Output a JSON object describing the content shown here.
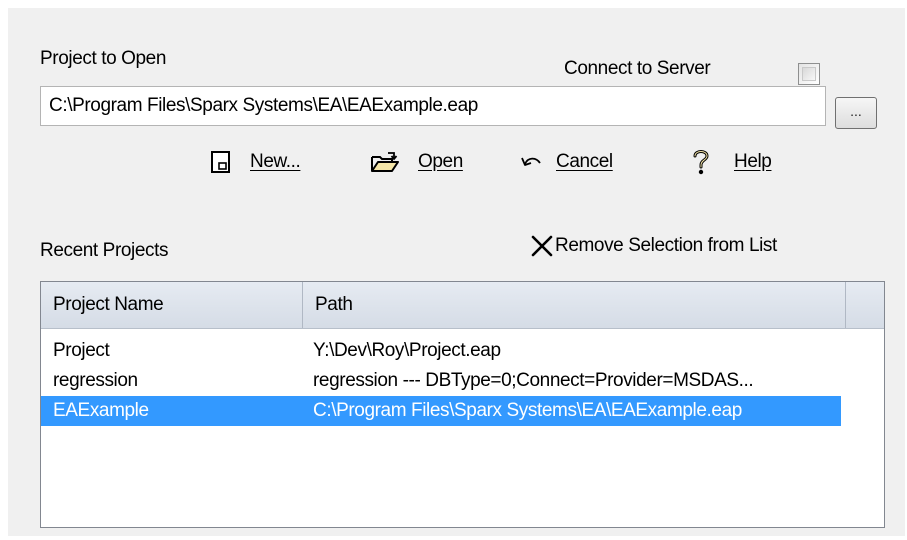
{
  "project": {
    "label": "Project to Open",
    "path_value": "C:\\Program Files\\Sparx Systems\\EA\\EAExample.eap",
    "browse_label": "..."
  },
  "server": {
    "label": "Connect to Server",
    "checked": false
  },
  "toolbar": {
    "new_label": "New...",
    "open_label": "Open",
    "cancel_label": "Cancel",
    "help_label": "Help"
  },
  "recent": {
    "label": "Recent Projects",
    "remove_label": "Remove Selection from List",
    "columns": [
      "Project Name",
      "Path"
    ],
    "rows": [
      {
        "name": "Project",
        "path": "Y:\\Dev\\Roy\\Project.eap"
      },
      {
        "name": "regression",
        "path": "regression --- DBType=0;Connect=Provider=MSDAS..."
      },
      {
        "name": "EAExample",
        "path": "C:\\Program Files\\Sparx Systems\\EA\\EAExample.eap"
      }
    ],
    "selected_index": 2
  },
  "colors": {
    "dialog_bg": "#f0f0f0",
    "selection": "#3399ff",
    "header_bg": "#dde3ec"
  },
  "icons": [
    "new-file-icon",
    "open-folder-icon",
    "undo-arrow-icon",
    "help-question-icon",
    "remove-x-icon"
  ]
}
